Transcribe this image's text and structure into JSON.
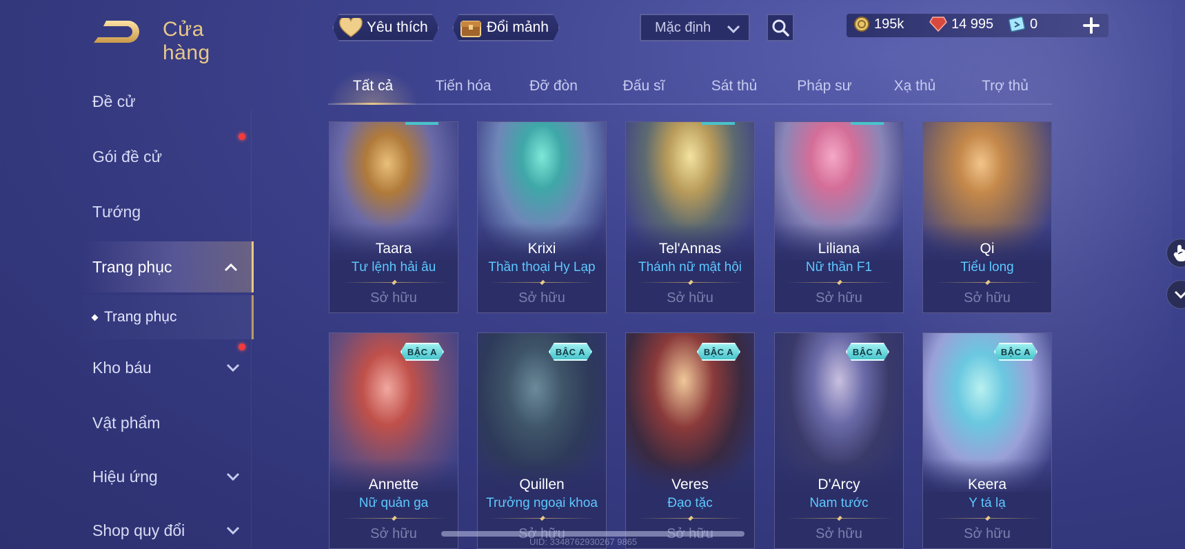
{
  "header": {
    "title": "Cửa hàng",
    "favorites_label": "Yêu thích",
    "exchange_label": "Đổi mảnh",
    "sort_value": "Mặc định"
  },
  "currency": {
    "gold": "195k",
    "vouchers": "14 995",
    "tickets": "0"
  },
  "sidebar": {
    "items": [
      {
        "label": "Đề cử"
      },
      {
        "label": "Gói đề cử"
      },
      {
        "label": "Tướng"
      },
      {
        "label": "Trang phục"
      },
      {
        "label": "Kho báu"
      },
      {
        "label": "Vật phẩm"
      },
      {
        "label": "Hiệu ứng"
      },
      {
        "label": "Shop quy đổi"
      }
    ],
    "sub_item": "Trang phục"
  },
  "tabs": [
    "Tất cả",
    "Tiến hóa",
    "Đỡ đòn",
    "Đấu sĩ",
    "Sát thủ",
    "Pháp sư",
    "Xạ thủ",
    "Trợ thủ"
  ],
  "cards": [
    {
      "hero": "Taara",
      "skin": "Tư lệnh hải âu",
      "status": "Sở hữu"
    },
    {
      "hero": "Krixi",
      "skin": "Thần thoại Hy Lạp",
      "status": "Sở hữu"
    },
    {
      "hero": "Tel'Annas",
      "skin": "Thánh nữ mật hội",
      "status": "Sở hữu"
    },
    {
      "hero": "Liliana",
      "skin": "Nữ thần F1",
      "status": "Sở hữu"
    },
    {
      "hero": "Qi",
      "skin": "Tiểu long",
      "status": "Sở hữu"
    },
    {
      "hero": "Annette",
      "skin": "Nữ quản ga",
      "status": "Sở hữu",
      "tier": "BẬC A"
    },
    {
      "hero": "Quillen",
      "skin": "Trưởng ngoại khoa",
      "status": "Sở hữu",
      "tier": "BẬC A"
    },
    {
      "hero": "Veres",
      "skin": "Đạo tặc",
      "status": "Sở hữu",
      "tier": "BẬC A"
    },
    {
      "hero": "D'Arcy",
      "skin": "Nam tước",
      "status": "Sở hữu",
      "tier": "BẬC A"
    },
    {
      "hero": "Keera",
      "skin": "Y tá lạ",
      "status": "Sở hữu",
      "tier": "BẬC A"
    }
  ],
  "footer": {
    "uid": "UID: 3348762930267 9865"
  },
  "colors": {
    "accent_gold": "#e8c889",
    "skin_name_blue": "#5ec8ff",
    "notification_red": "#f23b3b",
    "tier_badge": "#48c4cc"
  },
  "icons": {
    "back": "back-arrow-icon",
    "favorite": "heart-icon",
    "exchange": "chest-icon",
    "search": "search-icon",
    "gold": "gold-coin-icon",
    "voucher": "red-gem-icon",
    "ticket": "ticket-icon",
    "add": "plus-icon"
  }
}
